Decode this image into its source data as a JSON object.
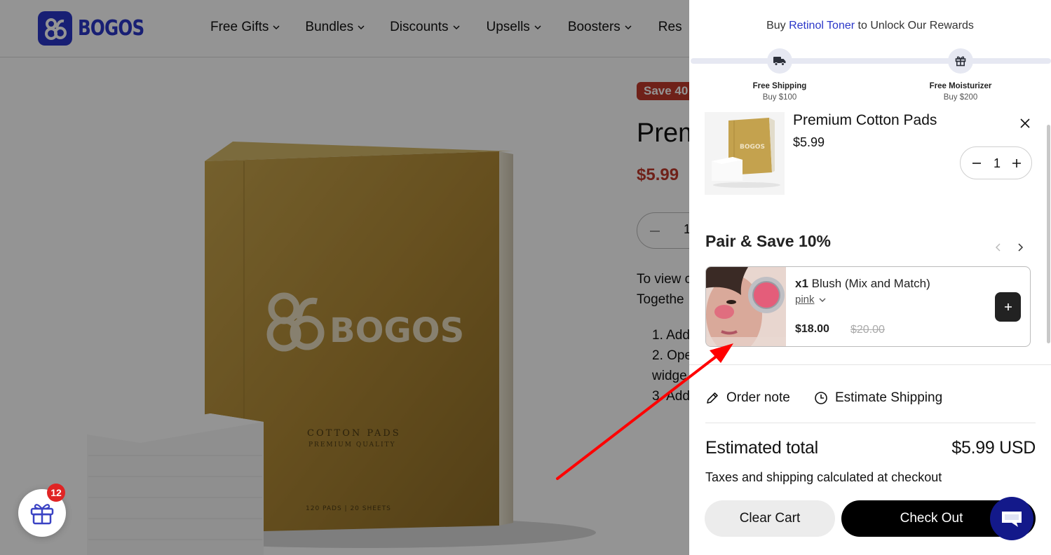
{
  "store": {
    "logo_text": "BOGOS",
    "nav": [
      {
        "label": "Free Gifts"
      },
      {
        "label": "Bundles"
      },
      {
        "label": "Discounts"
      },
      {
        "label": "Upsells"
      },
      {
        "label": "Boosters"
      },
      {
        "label": "Res"
      }
    ],
    "product": {
      "badge": "Save 40",
      "title": "Prem",
      "price": "$5.99",
      "quantity": "1",
      "desc_lines": [
        "To view c",
        "Togethe"
      ],
      "steps": [
        "1. Add",
        "2. Ope",
        "widge",
        "3. Add"
      ],
      "box_brand": "BOGOS",
      "box_label": "COTTON PADS",
      "box_sublabel": "PREMIUM QUALITY",
      "box_footer": "120 PADS  |  20 SHEETS"
    },
    "gift_button": {
      "badge_count": "12"
    }
  },
  "cart": {
    "rewards": {
      "prefix": "Buy ",
      "highlight": "Retinol Toner",
      "suffix": " to Unlock Our Rewards",
      "milestones": [
        {
          "title": "Free Shipping",
          "subtitle": "Buy $100",
          "icon": "truck-icon"
        },
        {
          "title": "Free Moisturizer",
          "subtitle": "Buy $200",
          "icon": "gift-icon"
        }
      ]
    },
    "item": {
      "name": "Premium Cotton Pads",
      "price": "$5.99",
      "quantity": "1",
      "thumb_brand": "BOGOS"
    },
    "upsell": {
      "title": "Pair & Save 10%",
      "qty_prefix": "x1",
      "name": " Blush (Mix and Match)",
      "variant": "pink",
      "price": "$18.00",
      "compare_price": "$20.00"
    },
    "actions": {
      "order_note": "Order note",
      "estimate_shipping": "Estimate Shipping"
    },
    "summary": {
      "total_label": "Estimated total",
      "total_value": "$5.99 USD",
      "tax_note": "Taxes and shipping calculated at checkout"
    },
    "buttons": {
      "clear": "Clear Cart",
      "checkout": "Check Out"
    }
  },
  "colors": {
    "brand": "#2a36c8",
    "sale": "#c0392b",
    "annotation_arrow": "#ff0000",
    "chat": "#13198a"
  }
}
